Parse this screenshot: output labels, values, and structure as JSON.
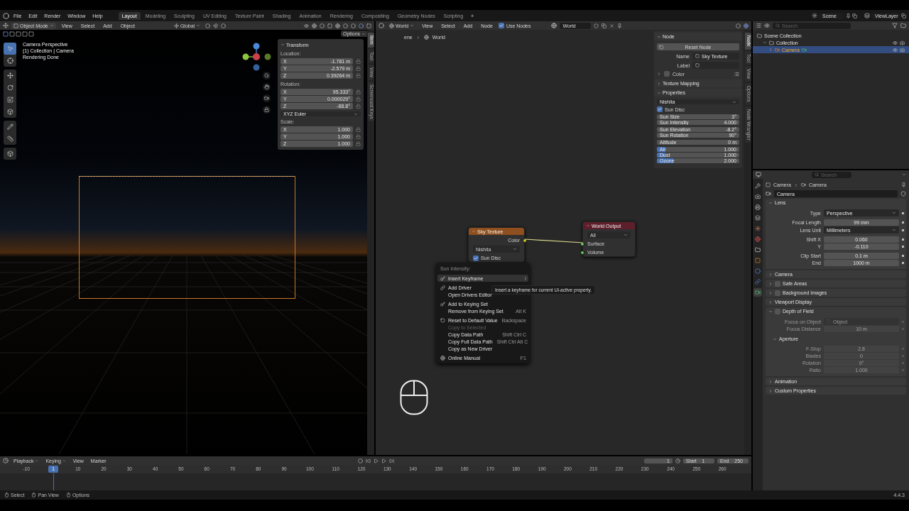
{
  "top_bar": {
    "menus": [
      "File",
      "Edit",
      "Render",
      "Window",
      "Help"
    ],
    "workspaces": [
      {
        "label": "Layout",
        "selected": true
      },
      {
        "label": "Modeling",
        "selected": false
      },
      {
        "label": "Sculpting",
        "selected": false
      },
      {
        "label": "UV Editing",
        "selected": false
      },
      {
        "label": "Texture Paint",
        "selected": false
      },
      {
        "label": "Shading",
        "selected": false
      },
      {
        "label": "Animation",
        "selected": false
      },
      {
        "label": "Rendering",
        "selected": false
      },
      {
        "label": "Compositing",
        "selected": false
      },
      {
        "label": "Geometry Nodes",
        "selected": false
      },
      {
        "label": "Scripting",
        "selected": false
      }
    ],
    "add_workspace": "+",
    "scene": "Scene",
    "view_layer": "ViewLayer"
  },
  "viewport": {
    "mode": "Object Mode",
    "menus": [
      "View",
      "Select",
      "Add",
      "Object"
    ],
    "orientation": "Global",
    "options": "Options",
    "info": [
      "Camera Perspective",
      "(1) Collection | Camera",
      "Rendering Done"
    ],
    "side_tabs": [
      {
        "label": "Item",
        "selected": true
      },
      {
        "label": "Tool",
        "selected": false
      },
      {
        "label": "View",
        "selected": false
      },
      {
        "label": "Screencast Keys",
        "selected": false
      }
    ],
    "transform": {
      "title": "Transform",
      "groups": [
        {
          "label": "Location:",
          "fields": [
            {
              "axis": "X",
              "value": "-1.781 m"
            },
            {
              "axis": "Y",
              "value": "-2.579 m"
            },
            {
              "axis": "Z",
              "value": "0.39264 m"
            }
          ]
        },
        {
          "label": "Rotation:",
          "fields": [
            {
              "axis": "X",
              "value": "95.333°"
            },
            {
              "axis": "Y",
              "value": "0.000029°"
            },
            {
              "axis": "Z",
              "value": "-88.8°"
            }
          ],
          "dropdown": "XYZ Euler"
        },
        {
          "label": "Scale:",
          "fields": [
            {
              "axis": "X",
              "value": "1.000"
            },
            {
              "axis": "Y",
              "value": "1.000"
            },
            {
              "axis": "Z",
              "value": "1.000"
            }
          ]
        }
      ]
    }
  },
  "node_editor": {
    "shader_type": "World",
    "menus": [
      "View",
      "Select",
      "Add",
      "Node"
    ],
    "use_nodes": {
      "label": "Use Nodes",
      "checked": true
    },
    "world": "World",
    "breadcrumb": [
      "ene",
      "World"
    ],
    "nodes": [
      {
        "kind": "sky",
        "title": "Sky Texture",
        "output": "Color",
        "dropdown": "Nishita",
        "checkbox": {
          "label": "Sun Disc",
          "checked": true
        }
      },
      {
        "kind": "output",
        "title": "World Output",
        "dropdown": "All",
        "inputs": [
          "Surface",
          "Volume"
        ]
      }
    ],
    "context_menu": {
      "title": "Sun Intensity:",
      "groups": [
        [
          {
            "label": "Insert Keyframe",
            "shortcut": "I",
            "selected": true,
            "disabled": false
          }
        ],
        [
          {
            "label": "Add Driver",
            "selected": false,
            "disabled": false
          },
          {
            "label": "Open Drivers Editor",
            "selected": false,
            "disabled": false
          }
        ],
        [
          {
            "label": "Add to Keying Set",
            "selected": false,
            "disabled": false
          },
          {
            "label": "Remove from Keying Set",
            "shortcut": "Alt K",
            "selected": false,
            "disabled": false
          }
        ],
        [
          {
            "label": "Reset to Default Value",
            "shortcut": "Backspace",
            "selected": false,
            "disabled": false
          },
          {
            "label": "Copy to Selected",
            "selected": false,
            "disabled": true
          },
          {
            "label": "Copy Data Path",
            "shortcut": "Shift Ctrl C",
            "selected": false,
            "disabled": false
          },
          {
            "label": "Copy Full Data Path",
            "shortcut": "Shift Ctrl Alt C",
            "selected": false,
            "disabled": false
          },
          {
            "label": "Copy as New Driver",
            "selected": false,
            "disabled": false
          }
        ],
        [
          {
            "label": "Online Manual",
            "shortcut": "F1",
            "selected": false,
            "disabled": false
          }
        ]
      ]
    },
    "tooltip": "Insert a keyframe for current UI-active property.",
    "sidebar": {
      "tabs": [
        {
          "label": "Node",
          "selected": true
        },
        {
          "label": "Tool",
          "selected": false
        },
        {
          "label": "View",
          "selected": false
        },
        {
          "label": "Options",
          "selected": false
        },
        {
          "label": "Node Wrangler",
          "selected": false
        }
      ],
      "node_panel": {
        "title": "Node",
        "reset": "Reset Node",
        "name_label": "Name",
        "name": "Sky Texture",
        "label_label": "Label",
        "color_label": "Color",
        "color_checked": false
      },
      "texture_mapping": "Texture Mapping",
      "properties": {
        "title": "Properties",
        "type": "Nishita",
        "sun_disc": {
          "label": "Sun Disc",
          "checked": true
        },
        "groups": [
          [
            {
              "label": "Sun Size",
              "value": "3°"
            },
            {
              "label": "Sun Intensity",
              "value": "4.000"
            }
          ],
          [
            {
              "label": "Sun Elevation",
              "value": "-8.2°"
            },
            {
              "label": "Sun Rotation",
              "value": "90°"
            }
          ],
          [
            {
              "label": "Altitude",
              "value": "0 m"
            }
          ],
          [
            {
              "label": "Air",
              "value": "1.000",
              "level": 0.1
            },
            {
              "label": "Dust",
              "value": "1.000",
              "level": 0.1
            },
            {
              "label": "Ozone",
              "value": "2.000",
              "level": 0.2
            }
          ]
        ]
      }
    }
  },
  "outliner": {
    "search_placeholder": "Search",
    "items": [
      {
        "label": "Scene Collection",
        "selected": false,
        "children": [
          {
            "label": "Collection",
            "selected": false,
            "children": [
              {
                "label": "Camera",
                "selected": true
              }
            ]
          }
        ]
      }
    ]
  },
  "properties": {
    "search_placeholder": "Search",
    "tabs": [
      {
        "kind": "tool",
        "selected": false
      },
      {
        "kind": "render",
        "selected": false
      },
      {
        "kind": "output",
        "selected": false
      },
      {
        "kind": "view_layer",
        "selected": false
      },
      {
        "kind": "scene",
        "selected": false
      },
      {
        "kind": "world",
        "selected": false
      },
      {
        "kind": "collection",
        "selected": false
      },
      {
        "kind": "object",
        "selected": false
      },
      {
        "kind": "physics",
        "selected": false
      },
      {
        "kind": "constraints",
        "selected": false
      },
      {
        "kind": "data",
        "selected": true
      }
    ],
    "breadcrumb": [
      "Camera",
      "Camera"
    ],
    "datablock": "Camera",
    "panels": [
      {
        "title": "Lens",
        "expanded": true,
        "groups": [
          [
            {
              "kind": "dropdown",
              "label": "Type",
              "value": "Perspective"
            }
          ],
          [
            {
              "kind": "number",
              "label": "Focal Length",
              "value": "99 mm"
            },
            {
              "kind": "dropdown",
              "label": "Lens Unit",
              "value": "Millimeters"
            }
          ],
          [
            {
              "kind": "number",
              "label": "Shift X",
              "value": "0.060"
            },
            {
              "kind": "number",
              "label": "Y",
              "value": "-0.110"
            }
          ],
          [
            {
              "kind": "number",
              "label": "Clip Start",
              "value": "0.1 m"
            },
            {
              "kind": "number",
              "label": "End",
              "value": "1000 m"
            }
          ]
        ]
      },
      {
        "title": "Camera",
        "expanded": false
      },
      {
        "title": "Safe Areas",
        "expanded": false,
        "enabled": false
      },
      {
        "title": "Background Images",
        "expanded": false,
        "enabled": false
      },
      {
        "title": "Viewport Display",
        "expanded": false
      },
      {
        "title": "Depth of Field",
        "expanded": true,
        "enabled": false,
        "groups": [
          [
            {
              "kind": "object",
              "label": "Focus on Object",
              "placeholder": "Object"
            },
            {
              "kind": "number",
              "label": "Focus Distance",
              "value": "10 m"
            }
          ]
        ],
        "subpanels": [
          {
            "title": "Aperture",
            "expanded": true,
            "groups": [
              [
                {
                  "kind": "number",
                  "label": "F-Stop",
                  "value": "2.8"
                },
                {
                  "kind": "number",
                  "label": "Blades",
                  "value": "0"
                },
                {
                  "kind": "number",
                  "label": "Rotation",
                  "value": "0°"
                },
                {
                  "kind": "number",
                  "label": "Ratio",
                  "value": "1.000"
                }
              ]
            ]
          }
        ]
      },
      {
        "title": "Animation",
        "expanded": false
      },
      {
        "title": "Custom Properties",
        "expanded": false
      }
    ]
  },
  "timeline": {
    "menus": [
      "Playback",
      "Keying",
      "View",
      "Marker"
    ],
    "current_frame": "1",
    "start_label": "Start",
    "start": "1",
    "end_label": "End",
    "end": "250",
    "playhead": "1",
    "ruler": [
      "-10",
      "10",
      "20",
      "30",
      "40",
      "50",
      "60",
      "70",
      "80",
      "90",
      "100",
      "110",
      "120",
      "130",
      "140",
      "150",
      "160",
      "170",
      "180",
      "190",
      "200",
      "210",
      "220",
      "230",
      "240",
      "250",
      "260"
    ]
  },
  "status_bar": {
    "items": [
      "Select",
      "Pan View",
      "Options"
    ],
    "version": "4.4.3"
  }
}
